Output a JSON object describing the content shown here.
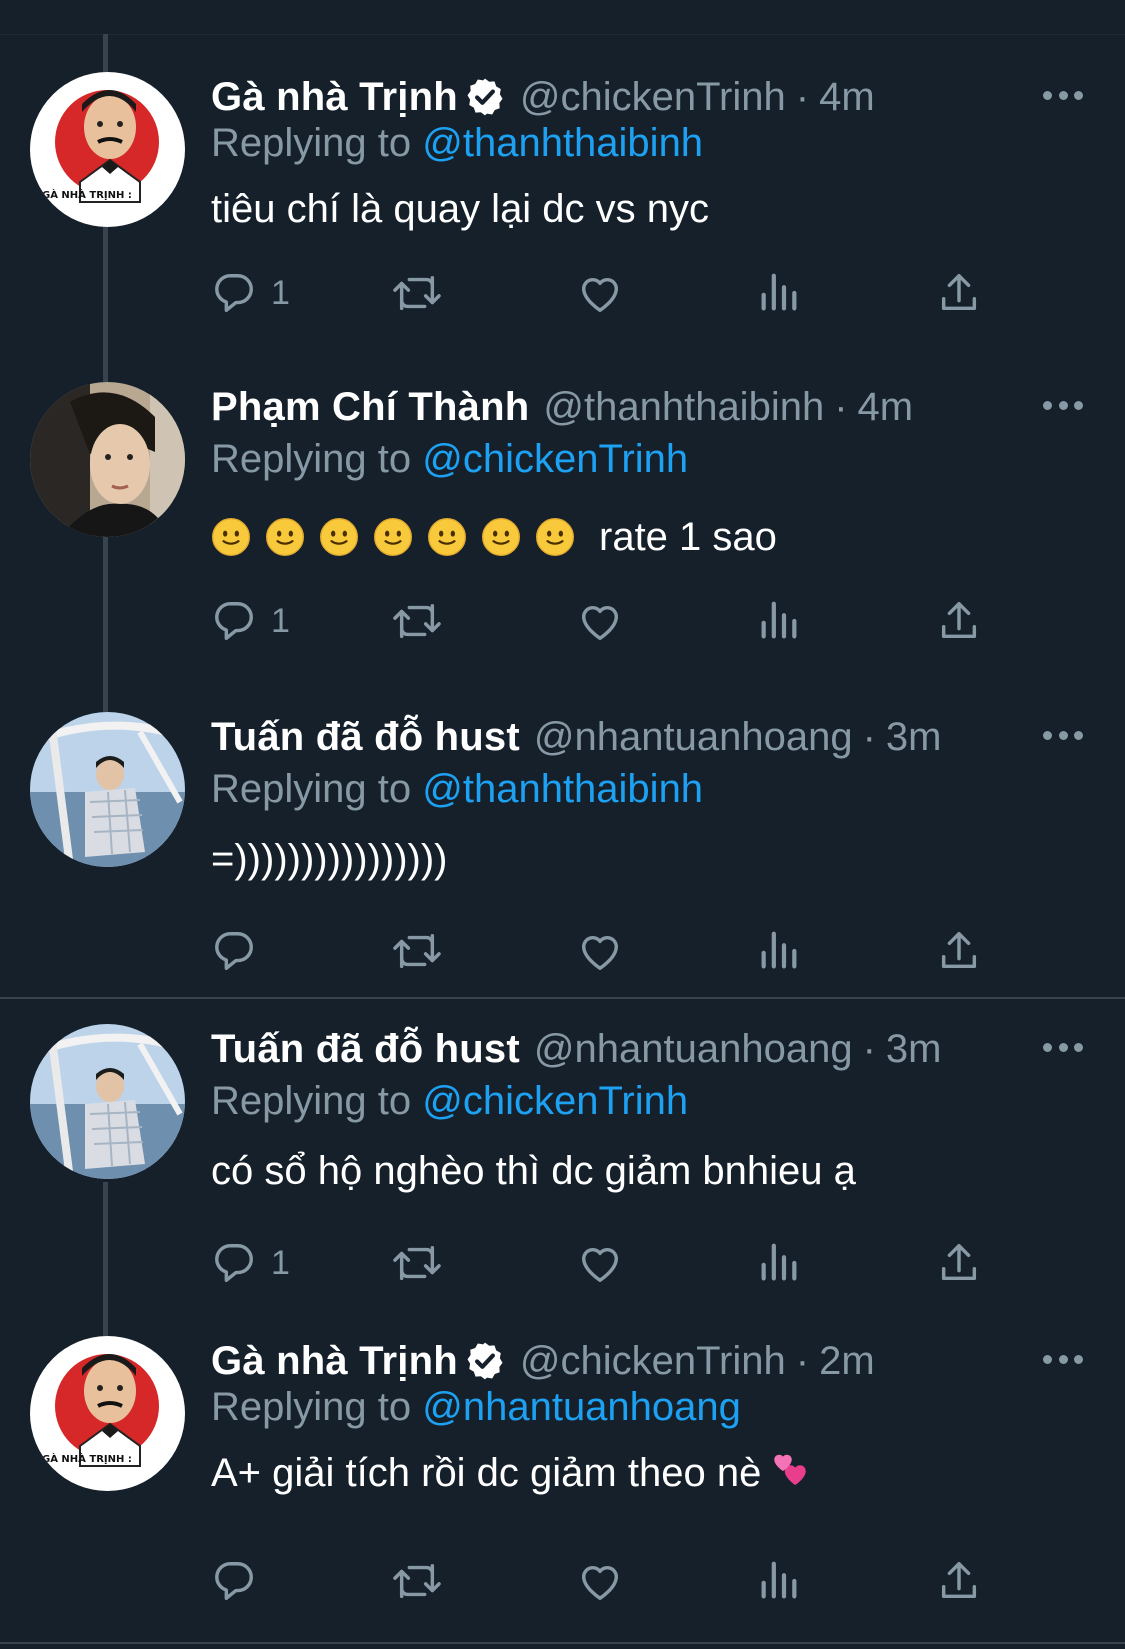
{
  "colors": {
    "background": "#15202b",
    "text_primary": "#ffffff",
    "text_secondary": "#8899a6",
    "link": "#1da1f2",
    "thread_line": "#38444d"
  },
  "tweets": [
    {
      "display_name": "Gà nhà Trịnh",
      "verified": true,
      "handle": "@chickenTrinh",
      "dot": "·",
      "time": "4m",
      "replying_label": "Replying to ",
      "replying_handle": "@thanhthaibinh",
      "text": "tiêu chí là quay lại dc vs nyc",
      "reply_count": "1",
      "avatar_caption": "GÀ NHÀ TRỊNH :",
      "icons": [
        "reply-icon",
        "retweet-icon",
        "like-icon",
        "analytics-icon",
        "share-icon"
      ]
    },
    {
      "display_name": "Phạm Chí Thành",
      "verified": false,
      "handle": "@thanhthaibinh",
      "dot": "·",
      "time": "4m",
      "replying_label": "Replying to ",
      "replying_handle": "@chickenTrinh",
      "text": "rate 1 sao",
      "emoji_prefix": "🙂🙂🙂🙂🙂🙂🙂",
      "reply_count": "1"
    },
    {
      "display_name": "Tuấn đã đỗ hust",
      "verified": false,
      "handle": "@nhantuanhoang",
      "dot": "·",
      "time": "3m",
      "replying_label": "Replying to ",
      "replying_handle": "@thanhthaibinh",
      "text": "=))))))))))))))))",
      "reply_count": ""
    },
    {
      "display_name": "Tuấn đã đỗ hust",
      "verified": false,
      "handle": "@nhantuanhoang",
      "dot": "·",
      "time": "3m",
      "replying_label": "Replying to ",
      "replying_handle": "@chickenTrinh",
      "text": "có sổ hộ nghèo thì dc giảm bnhieu ạ",
      "reply_count": "1"
    },
    {
      "display_name": "Gà nhà Trịnh",
      "verified": true,
      "handle": "@chickenTrinh",
      "dot": "·",
      "time": "2m",
      "replying_label": "Replying to ",
      "replying_handle": "@nhantuanhoang",
      "text": "A+ giải tích rồi dc giảm theo nè",
      "text_emoji": "💕",
      "reply_count": "",
      "avatar_caption": "GÀ NHÀ TRỊNH :"
    }
  ]
}
